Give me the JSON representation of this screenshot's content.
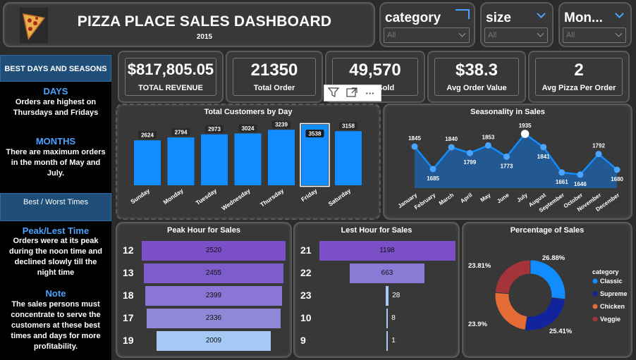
{
  "header": {
    "title": "PIZZA PLACE SALES DASHBOARD",
    "year": "2015"
  },
  "slicers": [
    {
      "label": "category",
      "value": "All"
    },
    {
      "label": "size",
      "value": "All"
    },
    {
      "label": "Mon...",
      "value": "All"
    }
  ],
  "sidebar": {
    "head1": "BEST DAYS AND SEASONS",
    "days_h": "DAYS",
    "days_t": "Orders are highest on Thursdays and Fridays",
    "months_h": "MONTHS",
    "months_t": "There are maximum orders in the month of May and July.",
    "head2": "Best / Worst Times",
    "peak_h": "Peak/Lest Time",
    "peak_t": "Orders were at its peak during the noon time and declined slowly till the night time",
    "note_h": "Note",
    "note_t": "The sales persons must concentrate to serve the customers at these best times and days for more profitability."
  },
  "kpis": [
    {
      "value": "$817,805.05",
      "label": "TOTAL REVENUE"
    },
    {
      "value": "21350",
      "label": "Total Order"
    },
    {
      "value": "49,570",
      "label": "Pizza Sold"
    },
    {
      "value": "$38.3",
      "label": "Avg Order Value"
    },
    {
      "value": "2",
      "label": "Avg Pizza Per Order"
    }
  ],
  "toolbar": {
    "filter": "filter-icon",
    "focus": "focus-mode-icon",
    "more": "more-options-icon"
  },
  "chart_data": [
    {
      "type": "bar",
      "title": "Total Customers by Day",
      "categories": [
        "Sunday",
        "Monday",
        "Tuesday",
        "Wednesday",
        "Thursday",
        "Friday",
        "Saturday"
      ],
      "values": [
        2624,
        2794,
        2973,
        3024,
        3239,
        3538,
        3158
      ],
      "color": "#118dff",
      "labels": [
        "2624",
        "2794",
        "2973",
        "3024",
        "3239",
        "3538",
        "3158"
      ]
    },
    {
      "type": "area",
      "title": "Seasonality in Sales",
      "categories": [
        "January",
        "February",
        "March",
        "April",
        "May",
        "June",
        "July",
        "August",
        "September",
        "October",
        "November",
        "December"
      ],
      "values": [
        1845,
        1685,
        1840,
        1799,
        1853,
        1773,
        1935,
        1841,
        1661,
        1646,
        1792,
        1680
      ],
      "color": "#118dff",
      "labels": [
        "1845",
        "1685",
        "1840",
        "1799",
        "1853",
        "1773",
        "1935",
        "1841",
        "1661",
        "1646",
        "1792",
        "1680"
      ]
    },
    {
      "type": "bar",
      "title": "Peak Hour for Sales",
      "categories": [
        "12",
        "13",
        "18",
        "17",
        "19"
      ],
      "values": [
        2520,
        2455,
        2399,
        2336,
        2009
      ],
      "labels": [
        "2520",
        "2455",
        "2399",
        "2336",
        "2009"
      ],
      "colors": [
        "#7b4fc6",
        "#7d5ccb",
        "#8a76d4",
        "#9187d9",
        "#a6c8f4"
      ]
    },
    {
      "type": "bar",
      "title": "Lest Hour for Sales",
      "categories": [
        "21",
        "22",
        "23",
        "10",
        "9"
      ],
      "values": [
        1198,
        663,
        28,
        8,
        1
      ],
      "labels": [
        "1198",
        "663",
        "28",
        "8",
        "1"
      ],
      "colors": [
        "#7b4fc6",
        "#8a7ad6",
        "#a6c8f4",
        "#a6c8f4",
        "#a6c8f4"
      ]
    },
    {
      "type": "pie",
      "title": "Percentage of Sales",
      "legend_title": "category",
      "categories": [
        "Classic",
        "Supreme",
        "Chicken",
        "Veggie"
      ],
      "values": [
        26.88,
        25.41,
        23.9,
        23.81
      ],
      "labels": [
        "26.88%",
        "25.41%",
        "23.9%",
        "23.81%"
      ],
      "colors": [
        "#118dff",
        "#12239e",
        "#e66c37",
        "#a4343a"
      ]
    }
  ]
}
